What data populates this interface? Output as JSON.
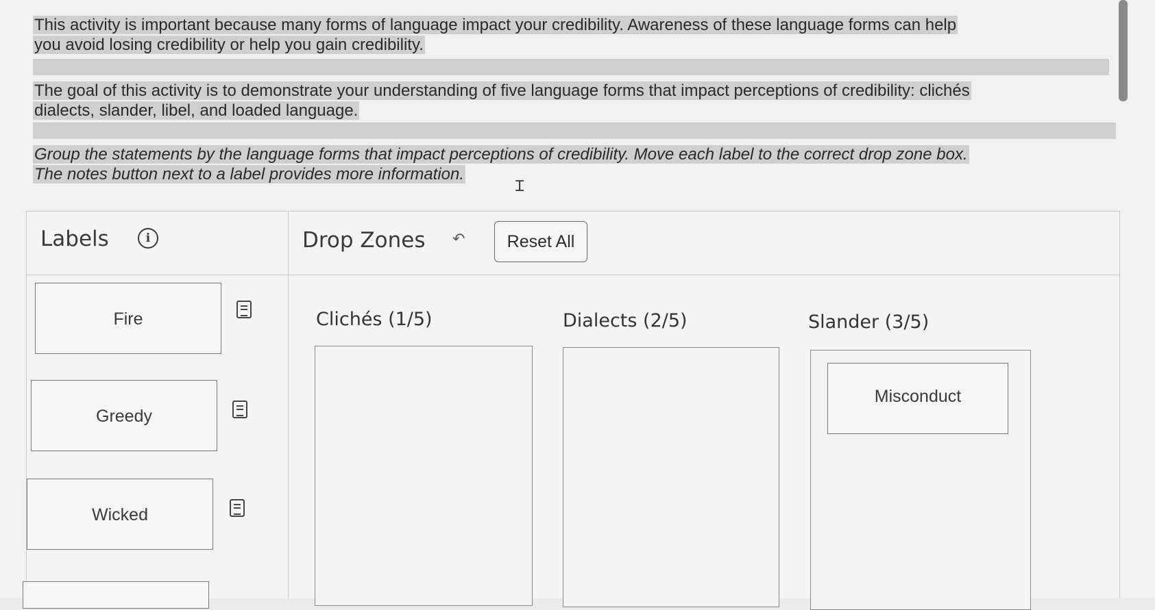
{
  "intro": {
    "p1_line1": "This activity is important because many forms of language impact your credibility. Awareness of these language forms can help",
    "p1_line2": "you avoid losing credibility or help you gain credibility.",
    "p2_line1": "The goal of this activity is to demonstrate your understanding of five language forms that impact perceptions of credibility: clichés",
    "p2_line2": "dialects, slander, libel, and loaded language.",
    "p3_line1": "Group the statements by the language forms that impact perceptions of credibility. Move each label to the correct drop zone box.",
    "p3_line2": "The notes button next to a label provides more information."
  },
  "labels_panel": {
    "heading": "Labels",
    "info_icon_glyph": "i",
    "items": [
      {
        "label": "Fire"
      },
      {
        "label": "Greedy"
      },
      {
        "label": "Wicked"
      }
    ]
  },
  "dropzones_panel": {
    "heading": "Drop Zones",
    "back_glyph": "↶",
    "reset_label": "Reset All",
    "zones": [
      {
        "title": "Clichés (1/5)",
        "placed": []
      },
      {
        "title": "Dialects (2/5)",
        "placed": []
      },
      {
        "title": "Slander (3/5)",
        "placed": [
          "Misconduct"
        ]
      }
    ]
  },
  "icons": {
    "info": "info-icon",
    "notes": "notes-icon",
    "back": "back-arrow-icon",
    "text_cursor": "text-cursor-icon"
  },
  "colors": {
    "highlight": "#cfcfcf",
    "border": "#777777",
    "background": "#f1f1f1"
  }
}
